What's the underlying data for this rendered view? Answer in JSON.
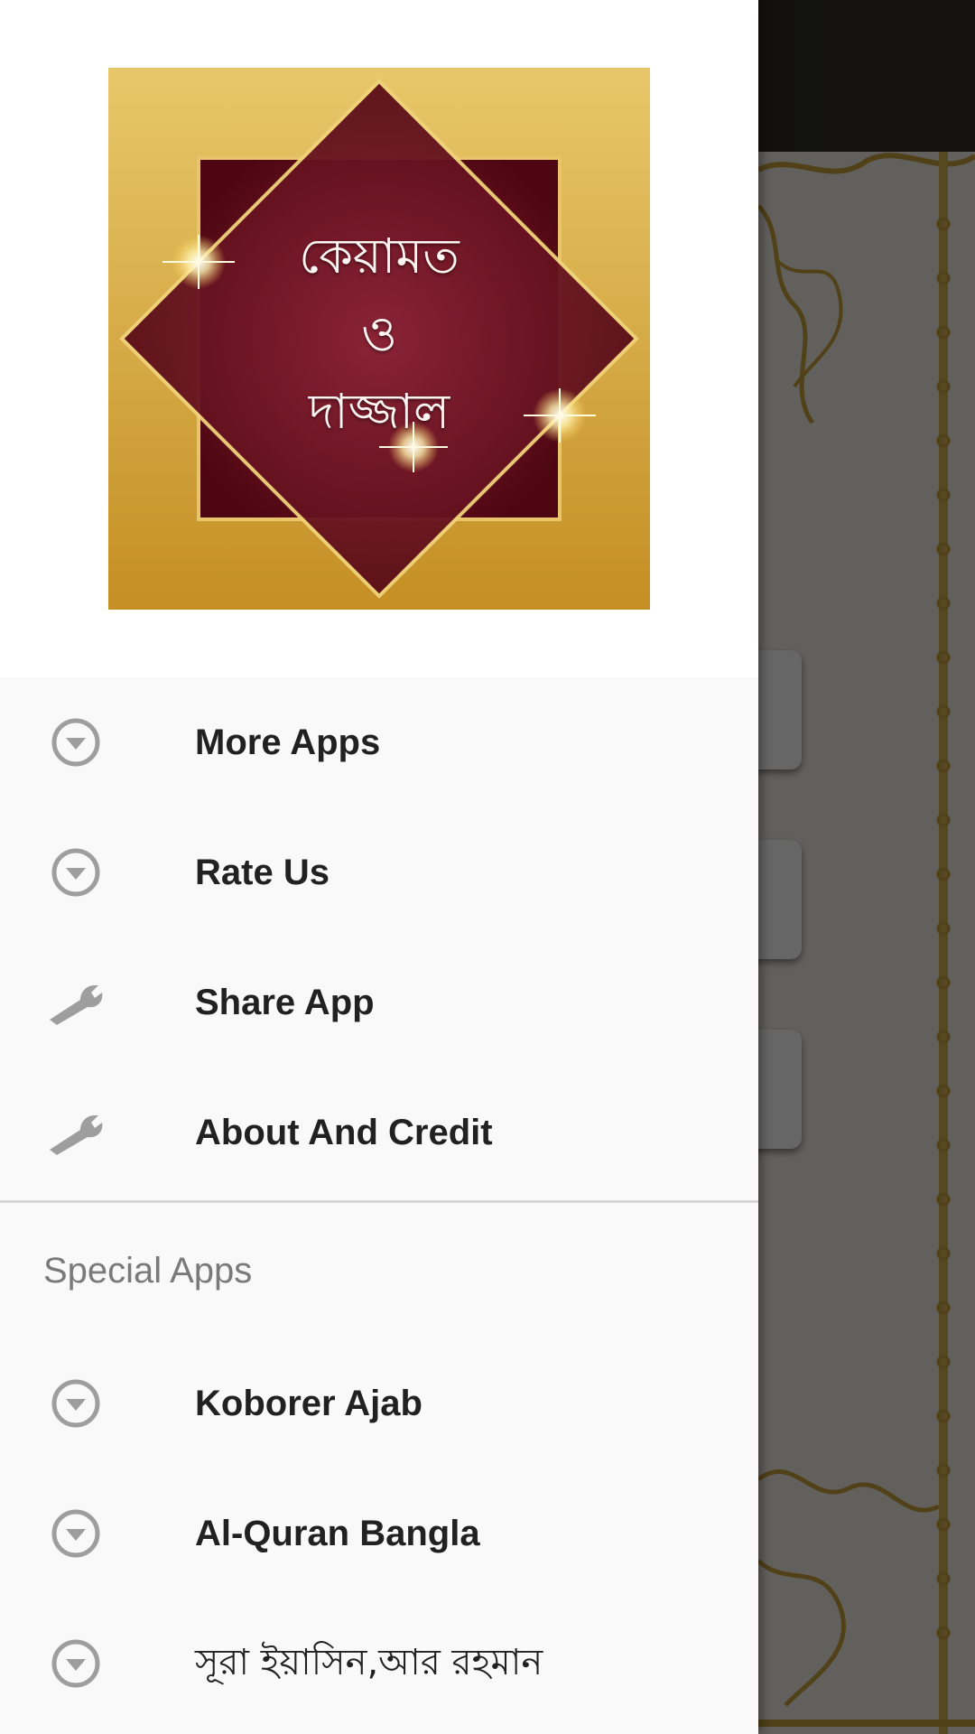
{
  "header": {
    "logo_line_1": "কেয়ামত",
    "logo_line_2": "ও",
    "logo_line_3": "দাজ্জাল",
    "logo_colors": {
      "gold": "#d6a93a",
      "maroon": "#5a0a14"
    }
  },
  "drawer": {
    "items": [
      {
        "label": "More Apps",
        "icon": "circle-chevron-down-icon"
      },
      {
        "label": "Rate Us",
        "icon": "circle-chevron-down-icon"
      },
      {
        "label": "Share App",
        "icon": "wrench-icon"
      },
      {
        "label": "About And Credit",
        "icon": "wrench-icon"
      }
    ],
    "section_title": "Special Apps",
    "special_items": [
      {
        "label": "Koborer Ajab",
        "icon": "circle-chevron-down-icon"
      },
      {
        "label": "Al-Quran Bangla",
        "icon": "circle-chevron-down-icon"
      },
      {
        "label": "সূরা ইয়াসিন,আর রহমান",
        "icon": "circle-chevron-down-icon"
      }
    ]
  },
  "colors": {
    "drawer_background": "#f9f9f9",
    "label_text": "#212121",
    "section_title_text": "#7a7a7a",
    "icon_gray": "#9e9e9e",
    "scrim": "rgba(0,0,0,0.6)"
  }
}
